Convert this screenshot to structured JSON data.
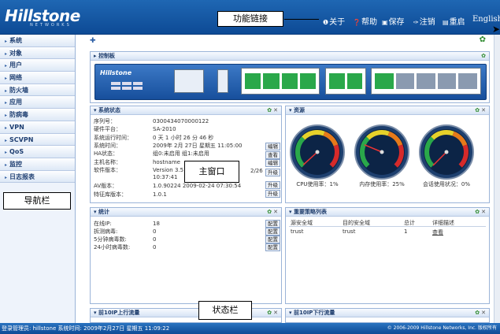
{
  "brand": {
    "logo": "Hillstone",
    "sub": "NETWORKS"
  },
  "topnav": {
    "about": "关于",
    "help": "帮助",
    "save": "保存",
    "logout": "注销",
    "restart": "重启",
    "lang": "English"
  },
  "callouts": {
    "links": "功能链接",
    "nav": "导航栏",
    "main": "主窗口",
    "status": "状态栏"
  },
  "sidebar": {
    "items": [
      "系统",
      "对象",
      "用户",
      "网络",
      "防火墙",
      "应用",
      "防病毒",
      "VPN",
      "SCVPN",
      "QoS",
      "监控",
      "日志报表"
    ]
  },
  "control_panel": {
    "title": "控制板",
    "device_logo": "Hillstone"
  },
  "sysinfo": {
    "title": "系统状态",
    "rows": [
      {
        "k": "序列号：",
        "v": "0300434070000122"
      },
      {
        "k": "硬件平台：",
        "v": "SA-2010"
      },
      {
        "k": "系统运行时间：",
        "v": "0 天 1 小时 26 分 46 秒"
      },
      {
        "k": "系统时间：",
        "v": "2009年 2月 27日 星期五 11:05:00"
      },
      {
        "k": "HA状态：",
        "v": "组0:未启用   组1:未启用"
      },
      {
        "k": "主机名称：",
        "v": "hostname"
      },
      {
        "k": "软件版本：",
        "v": "Version 3.5"
      },
      {
        "k": "",
        "v": "10:37:41"
      },
      {
        "k": "AV版本：",
        "v": "1.0.90224 2009-02-24 07:30:54"
      },
      {
        "k": "特征库版本：",
        "v": "1.0.1"
      }
    ],
    "btn_edit": "编辑",
    "btn_view": "查看",
    "btn_upgrade": "升级",
    "version_tail": "2/26"
  },
  "resources": {
    "title": "资源",
    "gauges": [
      {
        "label": "CPU使用率：1%",
        "value": 1
      },
      {
        "label": "内存使用率：25%",
        "value": 25
      },
      {
        "label": "会话使用状况：0%",
        "value": 0
      }
    ]
  },
  "stats": {
    "title": "统计",
    "rows": [
      {
        "k": "在线IP:",
        "v": "18"
      },
      {
        "k": "拆测病毒:",
        "v": "0"
      },
      {
        "k": "5分钟病毒数:",
        "v": "0"
      },
      {
        "k": "24小时病毒数:",
        "v": "0"
      }
    ],
    "btn": "配置"
  },
  "policy": {
    "title": "重要策略列表",
    "headers": [
      "源安全域",
      "目的安全域",
      "总计",
      "详细描述"
    ],
    "rows": [
      {
        "src": "trust",
        "dst": "trust",
        "total": "1",
        "detail": "查看"
      }
    ]
  },
  "bottom_panels": {
    "left": "前10IP上行流量",
    "right": "前10IP下行流量"
  },
  "status": {
    "left": "登录管理员: hillstone 系统时间: 2009年2月27日 星期五 11:09:22",
    "right": "© 2006-2009 Hillstone Networks, Inc. 版权所有"
  },
  "colors": {
    "header": "#1f67b3",
    "status": "#0d4a95",
    "accent": "#2d8a2d"
  }
}
